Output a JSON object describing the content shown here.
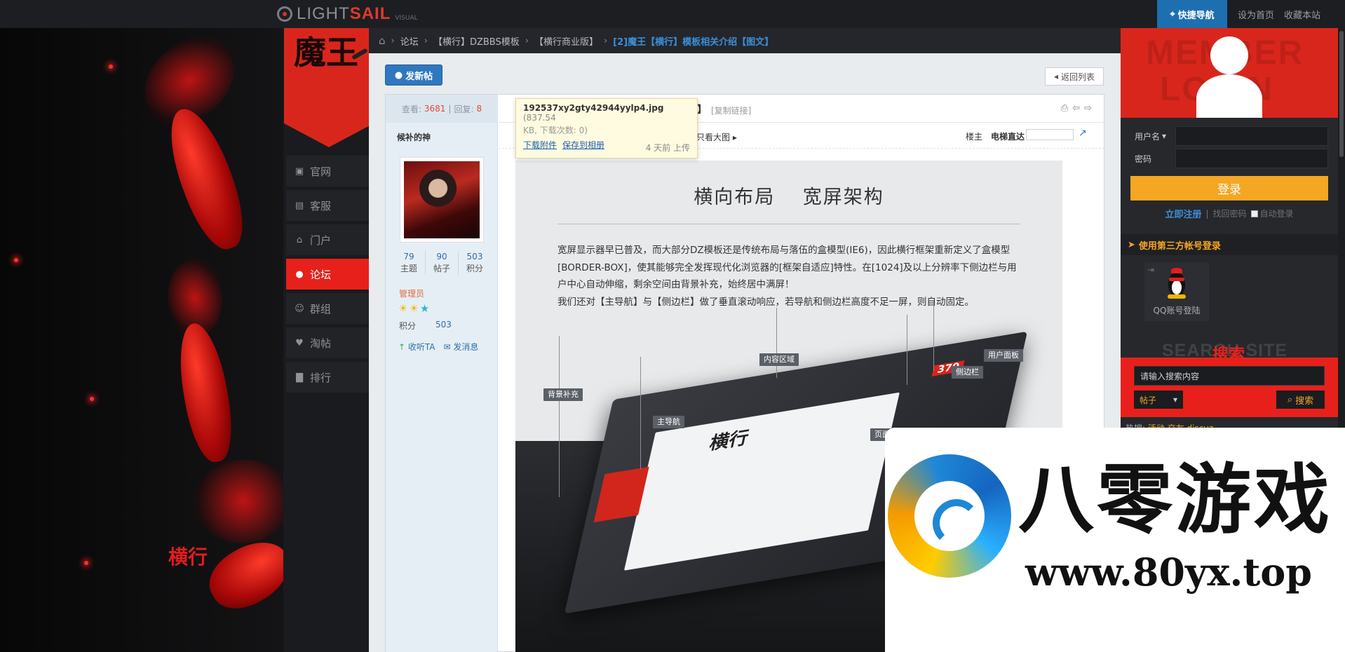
{
  "topbar": {
    "logo_light": "LIGHT",
    "logo_sail": "SAIL",
    "logo_sub": "VISUAL",
    "quick_nav": "快捷导航",
    "set_home": "设为首页",
    "bookmark": "收藏本站"
  },
  "brand": {
    "badge_text": "魔王",
    "bg_text": "横行"
  },
  "nav": {
    "items": [
      {
        "label": "官网",
        "icon": "building-icon"
      },
      {
        "label": "客服",
        "icon": "id-card-icon"
      },
      {
        "label": "门户",
        "icon": "home-icon"
      },
      {
        "label": "论坛",
        "icon": "chat-icon",
        "active": true
      },
      {
        "label": "群组",
        "icon": "users-icon"
      },
      {
        "label": "淘帖",
        "icon": "heart-icon"
      },
      {
        "label": "排行",
        "icon": "bar-chart-icon"
      }
    ]
  },
  "breadcrumb": [
    {
      "label": "论坛"
    },
    {
      "label": "【横行】DZBBS模板"
    },
    {
      "label": "【横行商业版】"
    },
    {
      "label": "[2]魔王【横行】模板相关介绍【图文】",
      "current": true
    }
  ],
  "actions": {
    "new_post": "发新帖",
    "back_to_list": "返回列表"
  },
  "post": {
    "views_label": "查看:",
    "views": "3681",
    "replies_label": "回复:",
    "replies": "8",
    "copy_link": "[复制链接]",
    "view_big": "只看大图",
    "floor_owner": "楼主",
    "elevator": "电梯直达",
    "bracket_close": "】"
  },
  "author": {
    "name": "候补的神",
    "stats": [
      {
        "value": "79",
        "label": "主题"
      },
      {
        "value": "90",
        "label": "帖子"
      },
      {
        "value": "503",
        "label": "积分"
      }
    ],
    "role": "管理员",
    "points_label": "积分",
    "points": "503",
    "follow": "收听TA",
    "message": "发消息"
  },
  "tooltip": {
    "filename": "192537xy2gty42944yylp4.jpg",
    "size": "(837.54",
    "info": "KB, 下载次数: 0)",
    "download": "下载附件",
    "save_album": "保存到相册",
    "uploaded": "4 天前 上传"
  },
  "article": {
    "title": "横向布局　 宽屏架构",
    "paragraphs": [
      "宽屏显示器早已普及，而大部分DZ模板还是传统布局与落伍的盒模型(IE6)，因此横行框架重新定义了盒模型[BORDER-BOX]，使其能够完全发挥现代化浏览器的[框架自适应]特性。在[1024]及以上分辨率下侧边栏与用户中心自动伸缩，剩余空间由背景补充，始终居中满屏！",
      "我们还对【主导航】与【侧边栏】做了垂直滚动响应，若导航和侧边栏高度不足一屏，则自动固定。"
    ],
    "callouts": {
      "bg_fill": "背景补充",
      "main_nav": "主导航",
      "content_area": "内容区域",
      "sidebar": "侧边栏",
      "user_panel": "用户面板",
      "page": "页面",
      "board_title": "横行",
      "counter": "370"
    }
  },
  "member": {
    "banner_ghost_1": "MEMBER",
    "banner_ghost_2": "LOGIN",
    "username_label": "用户名",
    "password_label": "密码",
    "username_value": "",
    "password_value": "",
    "login_button": "登录",
    "register": "立即注册",
    "forgot": "找回密码",
    "auto_login": "自动登录",
    "third_party": "使用第三方帐号登录",
    "qq_login": "QQ账号登陆"
  },
  "search": {
    "ghost": "SEARCH SITE",
    "title": "搜索",
    "placeholder": "请输入搜索内容",
    "type": "帖子",
    "button": "搜索",
    "hot_label": "热搜:",
    "hot_items": "活动 交友 discuz"
  },
  "watermark": {
    "title": "八零游戏",
    "url": "www.80yx.top"
  },
  "colors": {
    "accent_red": "#e8201b",
    "accent_blue": "#2f78bf",
    "accent_orange": "#f5a623"
  }
}
